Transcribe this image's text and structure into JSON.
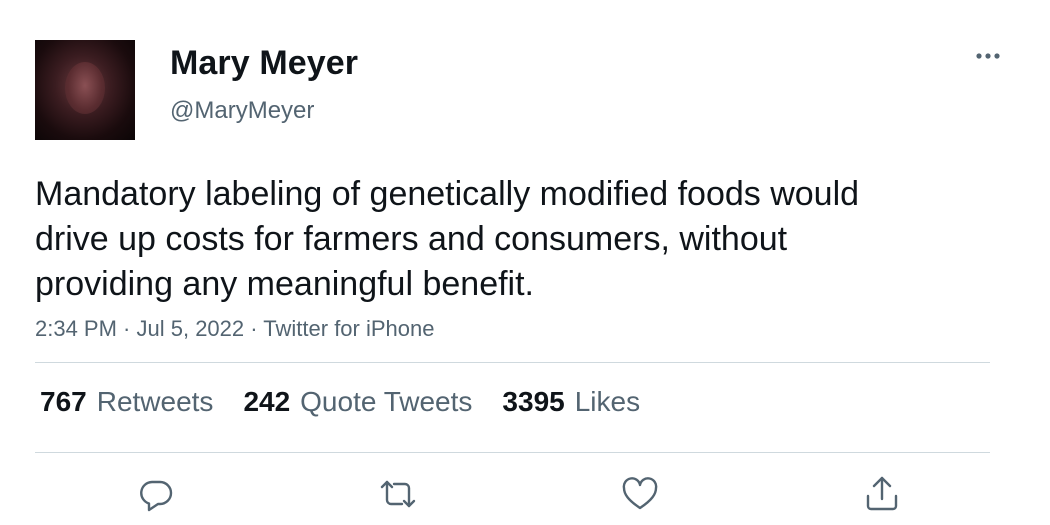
{
  "user": {
    "display_name": "Mary Meyer",
    "handle": "@MaryMeyer"
  },
  "tweet": {
    "text": "Mandatory labeling of genetically modified foods would\ndrive up costs for farmers and consumers, without\nproviding any meaningful benefit.",
    "time": "2:34 PM",
    "date": "Jul 5, 2022",
    "source": "Twitter for iPhone",
    "separator": " · "
  },
  "stats": {
    "retweets": {
      "count": "767",
      "label": "Retweets"
    },
    "quotes": {
      "count": "242",
      "label": "Quote Tweets"
    },
    "likes": {
      "count": "3395",
      "label": "Likes"
    }
  },
  "icons": {
    "more": "more-horizontal-icon",
    "reply": "reply-icon",
    "retweet": "retweet-icon",
    "like": "heart-icon",
    "share": "share-icon"
  },
  "colors": {
    "text": "#0f1419",
    "secondary": "#536471",
    "divider": "#cfd9de"
  }
}
